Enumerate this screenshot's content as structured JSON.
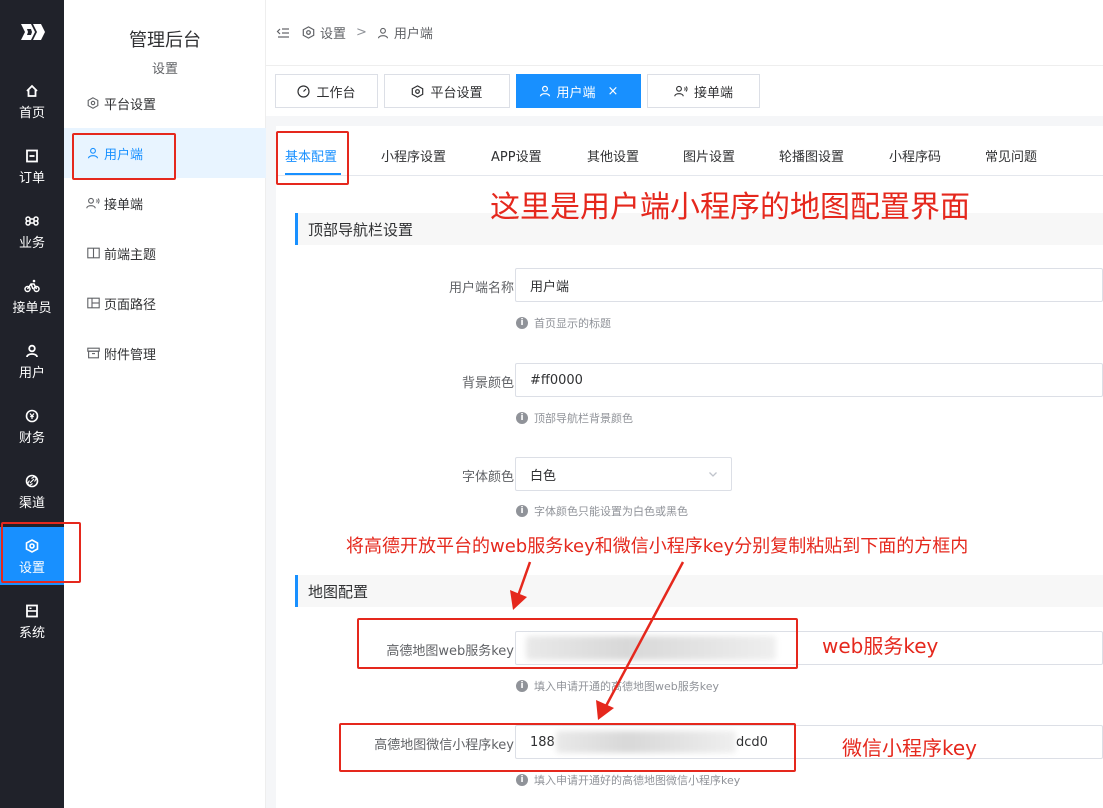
{
  "rail": {
    "items": [
      {
        "label": "首页",
        "icon": "home-icon"
      },
      {
        "label": "订单",
        "icon": "order-icon"
      },
      {
        "label": "业务",
        "icon": "command-icon"
      },
      {
        "label": "接单员",
        "icon": "bike-icon"
      },
      {
        "label": "用户",
        "icon": "user-icon"
      },
      {
        "label": "财务",
        "icon": "yen-icon"
      },
      {
        "label": "渠道",
        "icon": "link-icon"
      },
      {
        "label": "设置",
        "icon": "settings-icon"
      },
      {
        "label": "系统",
        "icon": "system-icon"
      }
    ],
    "active_index": 7,
    "accent": "#1890ff",
    "background": "#20222a"
  },
  "sidebar": {
    "title": "管理后台",
    "subtitle": "设置",
    "items": [
      {
        "label": "平台设置",
        "icon": "hexagon-gear-icon"
      },
      {
        "label": "用户端",
        "icon": "user-icon"
      },
      {
        "label": "接单端",
        "icon": "user-signal-icon"
      },
      {
        "label": "前端主题",
        "icon": "book-icon"
      },
      {
        "label": "页面路径",
        "icon": "layout-icon"
      },
      {
        "label": "附件管理",
        "icon": "archive-icon"
      }
    ],
    "active_index": 1
  },
  "breadcrumb": {
    "items": [
      "设置",
      "用户端"
    ],
    "separator": ">"
  },
  "tabs": {
    "items": [
      {
        "label": "工作台",
        "icon": "dashboard-icon"
      },
      {
        "label": "平台设置",
        "icon": "hexagon-gear-icon"
      },
      {
        "label": "用户端",
        "icon": "user-icon"
      },
      {
        "label": "接单端",
        "icon": "user-signal-icon"
      }
    ],
    "active_index": 2,
    "close_glyph": "×"
  },
  "subtabs": {
    "items": [
      "基本配置",
      "小程序设置",
      "APP设置",
      "其他设置",
      "图片设置",
      "轮播图设置",
      "小程序码",
      "常见问题"
    ],
    "active_index": 0
  },
  "sections": {
    "top_nav": "顶部导航栏设置",
    "map": "地图配置"
  },
  "form": {
    "app_name": {
      "label": "用户端名称",
      "value": "用户端",
      "hint": "首页显示的标题"
    },
    "bg_color": {
      "label": "背景颜色",
      "value": "#ff0000",
      "hint": "顶部导航栏背景颜色"
    },
    "font_color": {
      "label": "字体颜色",
      "value": "白色",
      "hint": "字体颜色只能设置为白色或黑色"
    },
    "amap_web_key": {
      "label": "高德地图web服务key",
      "value_visible_tail": "...0",
      "hint": "填入申请开通的高德地图web服务key"
    },
    "amap_wx_key": {
      "label": "高德地图微信小程序key",
      "value_head": "188",
      "value_tail": "dcd0",
      "hint": "填入申请开通好的高德地图微信小程序key"
    }
  },
  "annotations": {
    "heading": "这里是用户端小程序的地图配置界面",
    "instruction": "将高德开放平台的web服务key和微信小程序key分别复制粘贴到下面的方框内",
    "web_key_label": "web服务key",
    "wx_key_label": "微信小程序key",
    "color": "#e5281d"
  }
}
